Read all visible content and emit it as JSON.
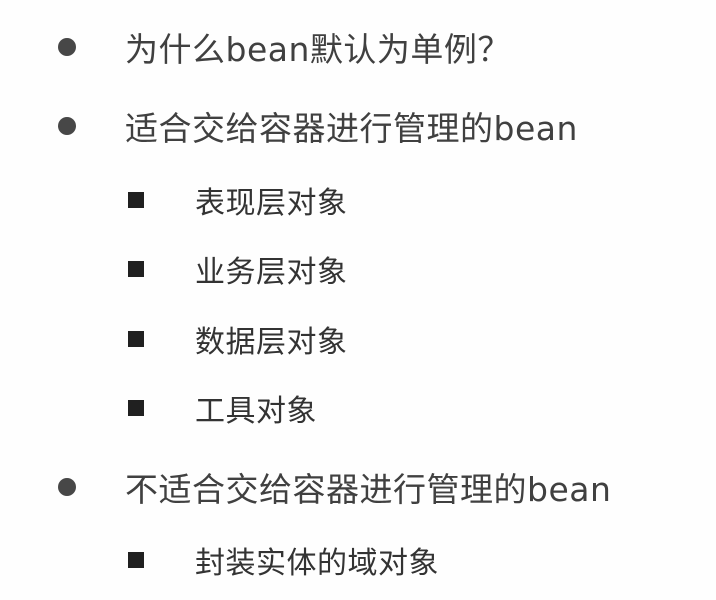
{
  "slide": {
    "items": [
      {
        "text": "为什么bean默认为单例？",
        "level": 1
      },
      {
        "text": "适合交给容器进行管理的bean",
        "level": 1,
        "children": [
          {
            "text": "表现层对象"
          },
          {
            "text": "业务层对象"
          },
          {
            "text": "数据层对象"
          },
          {
            "text": "工具对象"
          }
        ]
      },
      {
        "text": "不适合交给容器进行管理的bean",
        "level": 1,
        "children": [
          {
            "text": "封装实体的域对象"
          }
        ]
      }
    ]
  },
  "colors": {
    "text": "#3a3a3a",
    "dot_bullet": "#474747",
    "square_bullet": "#202020",
    "background": "#ffffff"
  },
  "icons": {
    "level1_bullet": "round-bullet-icon",
    "level2_bullet": "square-bullet-icon"
  }
}
